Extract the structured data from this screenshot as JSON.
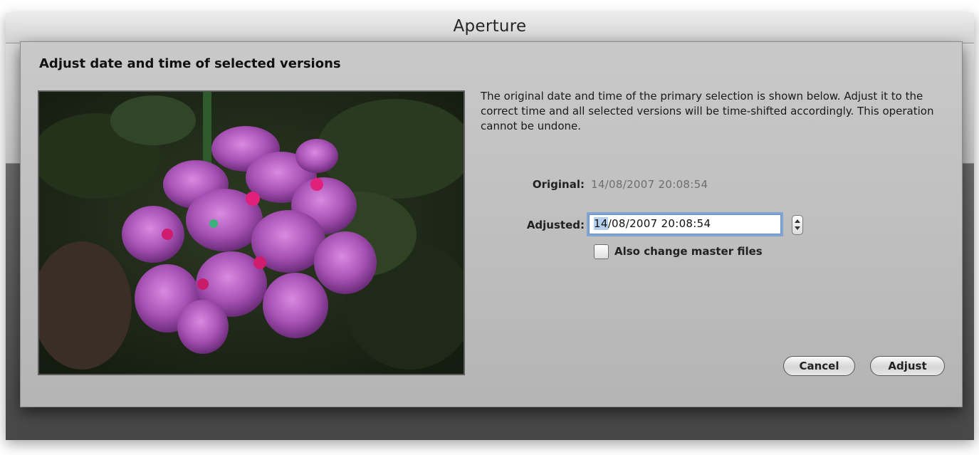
{
  "window": {
    "title": "Aperture"
  },
  "sheet": {
    "title": "Adjust date and time of selected versions",
    "description": "The original date and time of the primary selection is shown below. Adjust it to the correct time and all selected versions will be time-shifted accordingly. This operation cannot be undone.",
    "original_label": "Original:",
    "original_value": "14/08/2007 20:08:54",
    "adjusted_label": "Adjusted:",
    "adjusted_value_selected": "14",
    "adjusted_value_rest": "/08/2007 20:08:54",
    "checkbox_label": "Also change master files",
    "checkbox_checked": false,
    "cancel_label": "Cancel",
    "adjust_label": "Adjust"
  },
  "preview": {
    "subject": "pink geranium flower photo"
  },
  "icons": {
    "stepper": "stepper-arrows-icon"
  }
}
